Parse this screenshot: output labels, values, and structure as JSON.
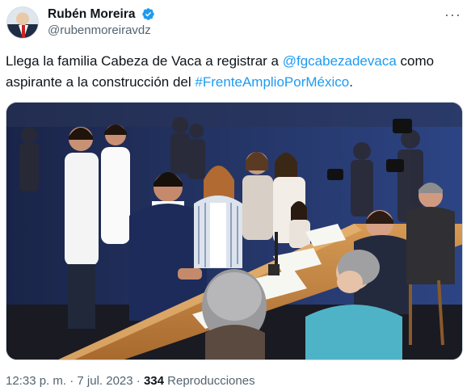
{
  "author": {
    "name": "Rubén Moreira",
    "handle": "@rubenmoreiravdz"
  },
  "tweet": {
    "text_part1": "Llega la familia Cabeza de Vaca a registrar a ",
    "mention": "@fgcabezadevaca",
    "text_part2": " como aspirante a la construcción del ",
    "hashtag": "#FrenteAmplioPorMéxico",
    "text_part3": "."
  },
  "meta": {
    "time": "12:33 p. m.",
    "separator1": " · ",
    "date": "7 jul. 2023",
    "separator2": " · ",
    "views_count": "334",
    "views_label": " Reproducciones"
  },
  "colors": {
    "link": "#1d9bf0",
    "verified": "#1d9bf0",
    "secondary_text": "#536471"
  },
  "icons": {
    "verified": "verified-badge-icon",
    "more": "more-options-icon"
  }
}
